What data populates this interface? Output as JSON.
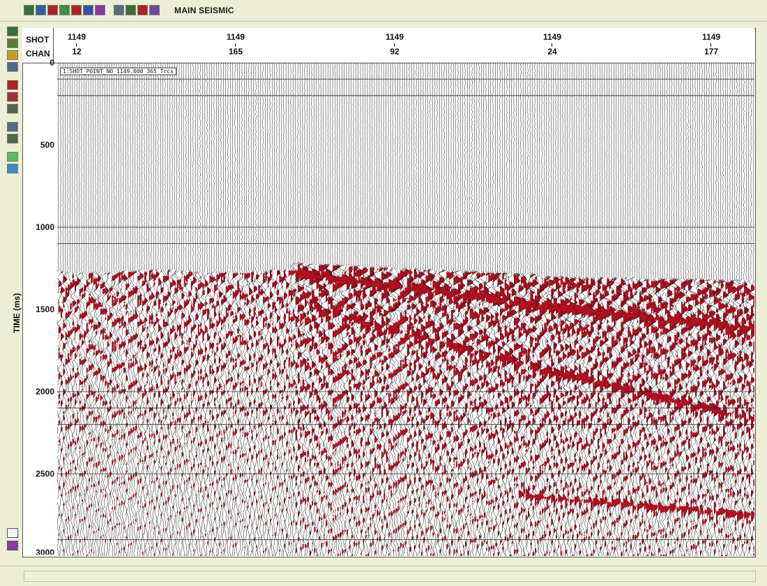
{
  "window": {
    "title": "MAIN SEISMIC"
  },
  "toolbar": {
    "icons": [
      {
        "name": "seismic-section-icon",
        "color": "#3a6e3a"
      },
      {
        "name": "trace-display-icon",
        "color": "#2f5fa0"
      },
      {
        "name": "color-fill-icon",
        "color": "#b0202a"
      },
      {
        "name": "spectrum-icon",
        "color": "#4a8a4a"
      },
      {
        "name": "wiggle-icon",
        "color": "#b0202a"
      },
      {
        "name": "palette-icon",
        "color": "#3b4fa8"
      },
      {
        "name": "color-bar-icon",
        "color": "#8a3aa0"
      },
      {
        "name": "zoom-icon",
        "color": "#5a6a8a"
      },
      {
        "name": "pick-icon",
        "color": "#3a6e3a"
      },
      {
        "name": "flag-icon",
        "color": "#b0202a"
      },
      {
        "name": "plot-icon",
        "color": "#6a4aa0"
      }
    ]
  },
  "left_tools": {
    "icons": [
      {
        "name": "view-icon",
        "color": "#3a6e3a"
      },
      {
        "name": "layer-icon",
        "color": "#5a7a3a"
      },
      {
        "name": "frame-icon",
        "color": "#c0a020"
      },
      {
        "name": "grid-icon",
        "color": "#4a6a8a"
      },
      {
        "name": "wiggle-variable-area-icon",
        "color": "#b0202a"
      },
      {
        "name": "density-icon",
        "color": "#a03040"
      },
      {
        "name": "trace-icon",
        "color": "#556655"
      },
      {
        "name": "header-icon",
        "color": "#5a6a8a"
      },
      {
        "name": "scale-icon",
        "color": "#4a6a4a"
      },
      {
        "name": "r-tool-icon",
        "color": "#5fb85f"
      },
      {
        "name": "s-tool-icon",
        "color": "#3b8ac4"
      }
    ],
    "bottom": [
      {
        "name": "pointer-icon",
        "color": "#f5f5f5"
      },
      {
        "name": "b-tool-icon",
        "color": "#8a3aa0"
      }
    ]
  },
  "plot": {
    "header_labels": {
      "shot": "SHOT",
      "chan": "CHAN"
    },
    "x_ticks": [
      {
        "shot": "1149",
        "chan": "12"
      },
      {
        "shot": "1149",
        "chan": "165"
      },
      {
        "shot": "1149",
        "chan": "92"
      },
      {
        "shot": "1149",
        "chan": "24"
      },
      {
        "shot": "1149",
        "chan": "177"
      }
    ],
    "y_axis_label": "TIME (ms)",
    "y_ticks": [
      "0",
      "500",
      "1000",
      "1500",
      "2000",
      "2500",
      "3000"
    ],
    "y_range": [
      0,
      3000
    ],
    "annotation": "1:SHOT_POINT_NO 1149.000 365 Trcs",
    "wiggle_color": "#111111",
    "fill_color": "#b01020",
    "grid": true
  }
}
